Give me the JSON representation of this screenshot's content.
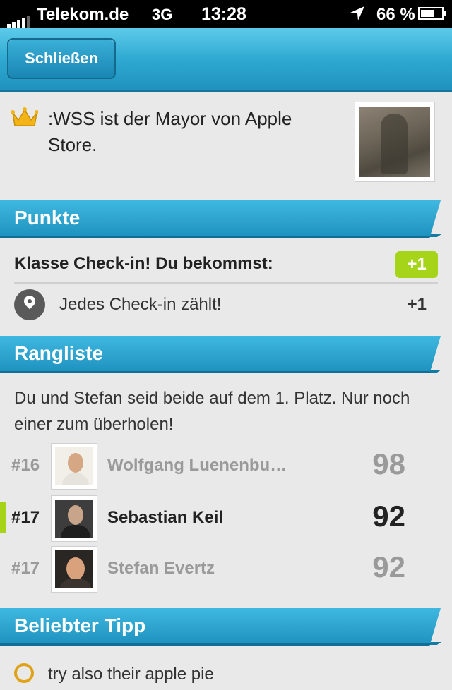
{
  "status_bar": {
    "carrier": "Telekom.de",
    "network": "3G",
    "time": "13:28",
    "battery": "66 %",
    "battery_level": 0.66
  },
  "nav": {
    "close_label": "Schließen"
  },
  "mayor": {
    "text": ":WSS ist der Mayor von Apple Store."
  },
  "sections": {
    "points_title": "Punkte",
    "leaderboard_title": "Rangliste",
    "tip_title": "Beliebter Tipp"
  },
  "points": {
    "headline": "Klasse Check-in! Du bekommst:",
    "total_badge": "+1",
    "items": [
      {
        "label": "Jedes Check-in zählt!",
        "value": "+1"
      }
    ]
  },
  "leaderboard": {
    "message": "Du und Stefan seid beide auf dem 1. Platz. Nur noch einer zum überholen!",
    "rows": [
      {
        "rank": "#16",
        "name": "Wolfgang Luenenbu…",
        "score": "98"
      },
      {
        "rank": "#17",
        "name": "Sebastian Keil",
        "score": "92"
      },
      {
        "rank": "#17",
        "name": "Stefan Evertz",
        "score": "92"
      }
    ]
  },
  "tip": {
    "text": "try also their apple pie"
  },
  "colors": {
    "accent_blue": "#2ea9d1",
    "badge_green": "#a6d419",
    "crown_gold": "#f2b417"
  }
}
